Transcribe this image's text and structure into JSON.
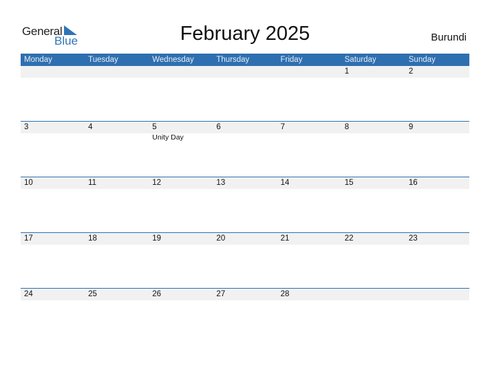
{
  "logo": {
    "general": "General",
    "blue": "Blue",
    "icon": "triangle-flag-icon",
    "accent": "#2e75b6"
  },
  "title": "February 2025",
  "country": "Burundi",
  "colors": {
    "header_bg": "#2e6fb0",
    "date_strip": "#f1f1f1"
  },
  "weekdays": [
    "Monday",
    "Tuesday",
    "Wednesday",
    "Thursday",
    "Friday",
    "Saturday",
    "Sunday"
  ],
  "weeks": [
    [
      {
        "day": ""
      },
      {
        "day": ""
      },
      {
        "day": ""
      },
      {
        "day": ""
      },
      {
        "day": ""
      },
      {
        "day": "1"
      },
      {
        "day": "2"
      }
    ],
    [
      {
        "day": "3"
      },
      {
        "day": "4"
      },
      {
        "day": "5",
        "event": "Unity Day"
      },
      {
        "day": "6"
      },
      {
        "day": "7"
      },
      {
        "day": "8"
      },
      {
        "day": "9"
      }
    ],
    [
      {
        "day": "10"
      },
      {
        "day": "11"
      },
      {
        "day": "12"
      },
      {
        "day": "13"
      },
      {
        "day": "14"
      },
      {
        "day": "15"
      },
      {
        "day": "16"
      }
    ],
    [
      {
        "day": "17"
      },
      {
        "day": "18"
      },
      {
        "day": "19"
      },
      {
        "day": "20"
      },
      {
        "day": "21"
      },
      {
        "day": "22"
      },
      {
        "day": "23"
      }
    ],
    [
      {
        "day": "24"
      },
      {
        "day": "25"
      },
      {
        "day": "26"
      },
      {
        "day": "27"
      },
      {
        "day": "28"
      },
      {
        "day": ""
      },
      {
        "day": ""
      }
    ]
  ]
}
